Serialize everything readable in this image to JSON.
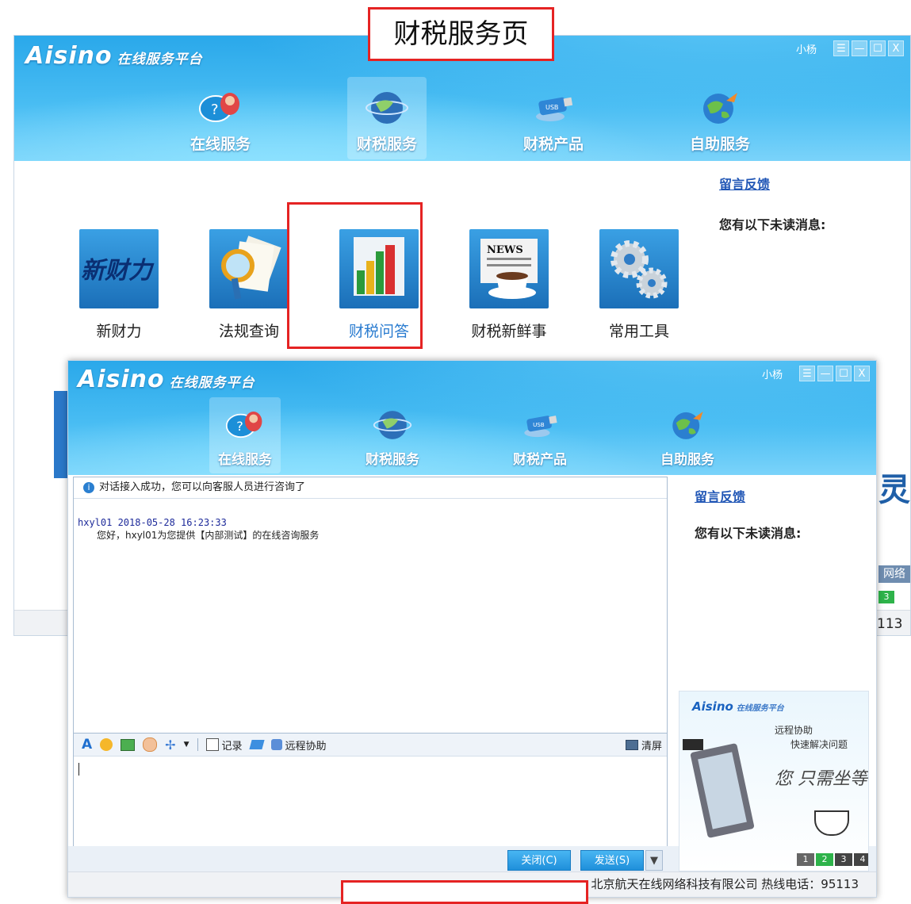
{
  "annotation": {
    "title": "财税服务页"
  },
  "back_window": {
    "brand": "Aisino",
    "brand_sub": "在线服务平台",
    "user": "小杨",
    "controls": [
      "☰",
      "—",
      "☐",
      "X"
    ],
    "nav": [
      {
        "label": "在线服务",
        "icon": "chat-bubbles-icon"
      },
      {
        "label": "财税服务",
        "icon": "globe-icon"
      },
      {
        "label": "财税产品",
        "icon": "usb-drive-icon"
      },
      {
        "label": "自助服务",
        "icon": "earth-icon"
      }
    ],
    "tiles": [
      {
        "label": "新财力",
        "icon": "xincaili-logo-icon"
      },
      {
        "label": "法规查询",
        "icon": "magnifier-documents-icon"
      },
      {
        "label": "财税问答",
        "icon": "bar-chart-icon"
      },
      {
        "label": "财税新鲜事",
        "icon": "news-coffee-icon"
      },
      {
        "label": "常用工具",
        "icon": "gears-icon"
      }
    ],
    "feedback_link": "留言反馈",
    "unread_label": "您有以下未读消息:",
    "partial_text": {
      "frag1": "灵",
      "frag2": "网络",
      "frag3": "3",
      "hotline_tail": "113"
    }
  },
  "front_window": {
    "brand": "Aisino",
    "brand_sub": "在线服务平台",
    "user": "小杨",
    "controls": [
      "☰",
      "—",
      "☐",
      "X"
    ],
    "nav": [
      {
        "label": "在线服务",
        "icon": "chat-bubbles-icon"
      },
      {
        "label": "财税服务",
        "icon": "globe-icon"
      },
      {
        "label": "财税产品",
        "icon": "usb-drive-icon"
      },
      {
        "label": "自助服务",
        "icon": "earth-icon"
      }
    ],
    "chat": {
      "notice": "对话接入成功，您可以向客服人员进行咨询了",
      "sender_line": "hxyl01  2018-05-28 16:23:33",
      "message": "您好，hxyl01为您提供【内部测试】的在线咨询服务"
    },
    "toolbar": {
      "record": "记录",
      "remote": "远程协助",
      "clear": "清屏"
    },
    "buttons": {
      "close": "关闭(C)",
      "send": "发送(S)"
    },
    "feedback_link": "留言反馈",
    "unread_label": "您有以下未读消息:",
    "ad": {
      "brand": "Aisino",
      "brand_sub": "在线服务平台",
      "line1": "远程协助",
      "line2": "快速解决问题",
      "slogan": "您 只需坐等",
      "pages": [
        "1",
        "2",
        "3",
        "4"
      ]
    },
    "status": "北京航天在线网络科技有限公司   热线电话：95113"
  },
  "colors": {
    "header_blue": "#2aa8ea",
    "link_blue": "#1f55b5",
    "annotation_red": "#e52323"
  }
}
